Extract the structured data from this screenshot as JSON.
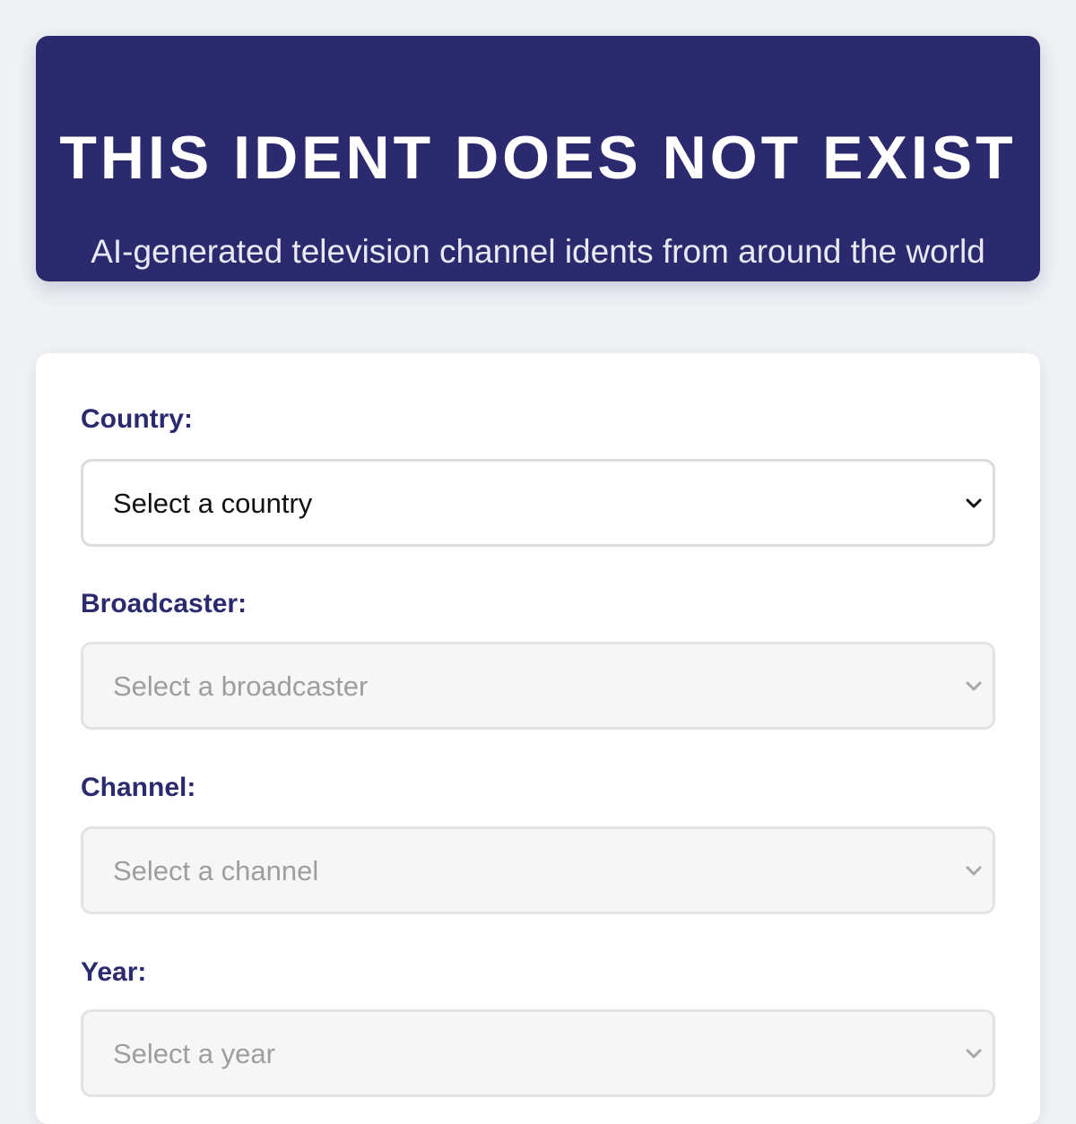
{
  "header": {
    "title": "THIS IDENT DOES NOT EXIST",
    "subtitle": "AI-generated television channel idents from around the world"
  },
  "form": {
    "country": {
      "label": "Country:",
      "value": "Select a country",
      "disabled": false
    },
    "broadcaster": {
      "label": "Broadcaster:",
      "value": "Select a broadcaster",
      "disabled": true
    },
    "channel": {
      "label": "Channel:",
      "value": "Select a channel",
      "disabled": true
    },
    "year": {
      "label": "Year:",
      "value": "Select a year",
      "disabled": true
    }
  },
  "colors": {
    "brand": "#2b2a6f",
    "page_background": "#eff1f5",
    "card_background": "#ffffff",
    "disabled_text": "#9e9e9e"
  },
  "icons": {
    "dropdown": "chevron-down-icon"
  }
}
